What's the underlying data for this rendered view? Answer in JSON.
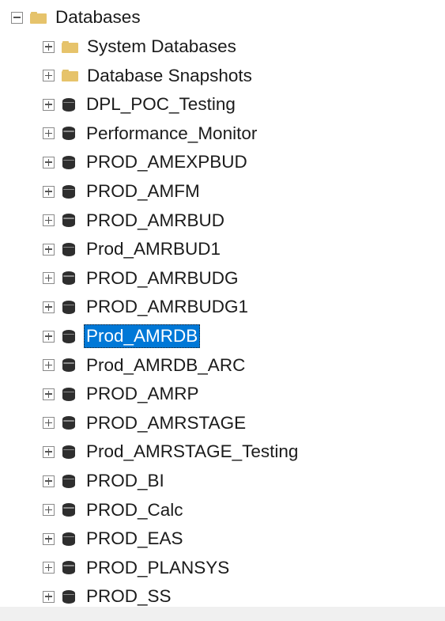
{
  "tree": {
    "root": {
      "label": "Databases",
      "expanded": true,
      "icon": "folder-icon"
    },
    "children": [
      {
        "label": "System Databases",
        "icon": "folder-icon",
        "expanded": false,
        "selected": false
      },
      {
        "label": "Database Snapshots",
        "icon": "folder-icon",
        "expanded": false,
        "selected": false
      },
      {
        "label": "DPL_POC_Testing",
        "icon": "database-icon",
        "expanded": false,
        "selected": false
      },
      {
        "label": "Performance_Monitor",
        "icon": "database-icon",
        "expanded": false,
        "selected": false
      },
      {
        "label": "PROD_AMEXPBUD",
        "icon": "database-icon",
        "expanded": false,
        "selected": false
      },
      {
        "label": "PROD_AMFM",
        "icon": "database-icon",
        "expanded": false,
        "selected": false
      },
      {
        "label": "PROD_AMRBUD",
        "icon": "database-icon",
        "expanded": false,
        "selected": false
      },
      {
        "label": "Prod_AMRBUD1",
        "icon": "database-icon",
        "expanded": false,
        "selected": false
      },
      {
        "label": "PROD_AMRBUDG",
        "icon": "database-icon",
        "expanded": false,
        "selected": false
      },
      {
        "label": "PROD_AMRBUDG1",
        "icon": "database-icon",
        "expanded": false,
        "selected": false
      },
      {
        "label": "Prod_AMRDB",
        "icon": "database-icon",
        "expanded": false,
        "selected": true
      },
      {
        "label": "Prod_AMRDB_ARC",
        "icon": "database-icon",
        "expanded": false,
        "selected": false
      },
      {
        "label": "PROD_AMRP",
        "icon": "database-icon",
        "expanded": false,
        "selected": false
      },
      {
        "label": "PROD_AMRSTAGE",
        "icon": "database-icon",
        "expanded": false,
        "selected": false
      },
      {
        "label": "Prod_AMRSTAGE_Testing",
        "icon": "database-icon",
        "expanded": false,
        "selected": false
      },
      {
        "label": "PROD_BI",
        "icon": "database-icon",
        "expanded": false,
        "selected": false
      },
      {
        "label": "PROD_Calc",
        "icon": "database-icon",
        "expanded": false,
        "selected": false
      },
      {
        "label": "PROD_EAS",
        "icon": "database-icon",
        "expanded": false,
        "selected": false
      },
      {
        "label": "PROD_PLANSYS",
        "icon": "database-icon",
        "expanded": false,
        "selected": false
      },
      {
        "label": "PROD_SS",
        "icon": "database-icon",
        "expanded": false,
        "selected": false
      }
    ]
  },
  "colors": {
    "selection": "#0078d7",
    "folder": "#e6c36b",
    "database": "#2e2e2e",
    "text": "#1b1b1b"
  }
}
